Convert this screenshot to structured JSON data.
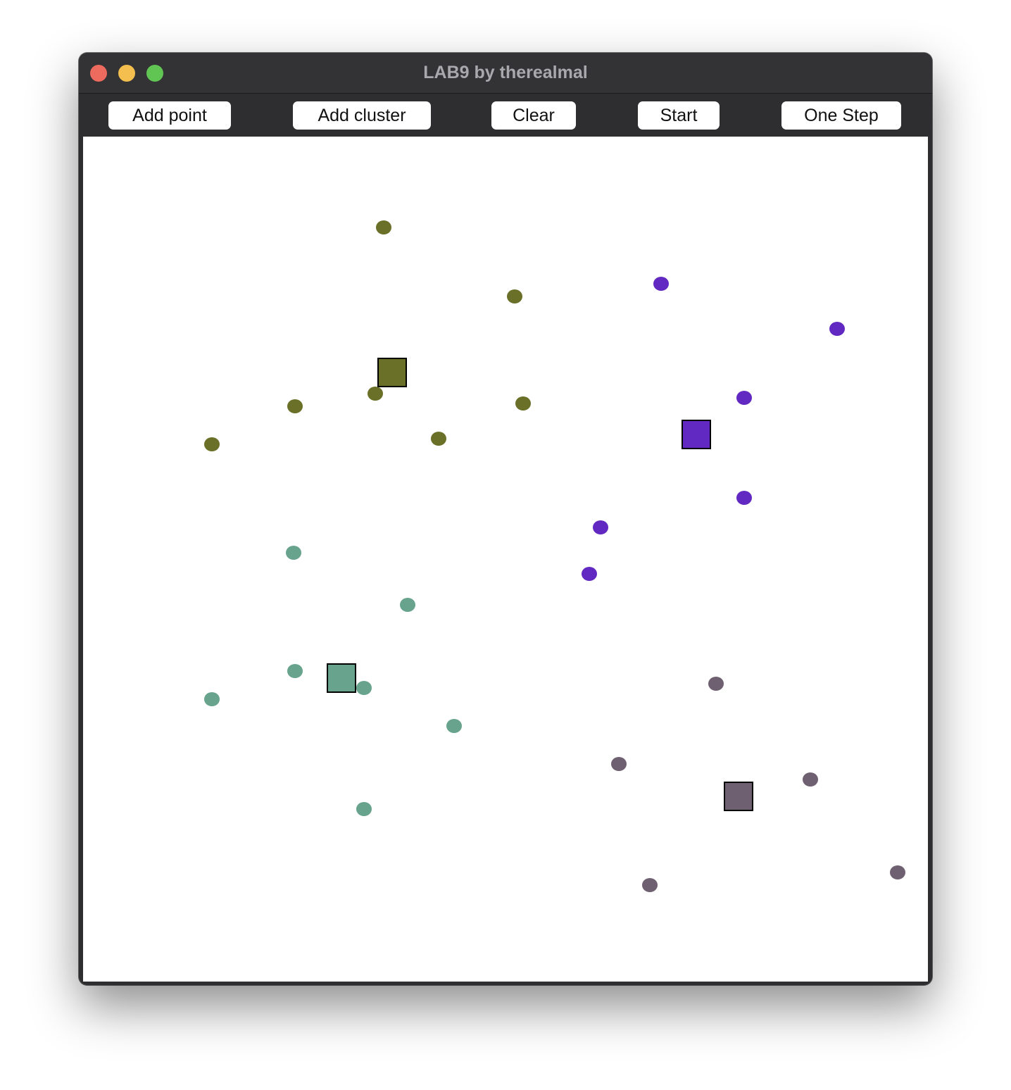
{
  "window": {
    "title": "LAB9 by therealmal"
  },
  "toolbar": {
    "add_point": "Add point",
    "add_cluster": "Add cluster",
    "clear": "Clear",
    "start": "Start",
    "one_step": "One Step"
  },
  "clusters": [
    {
      "color": "#6b7028",
      "center": [
        439,
        335
      ],
      "points": [
        [
          427,
          129
        ],
        [
          613,
          227
        ],
        [
          415,
          365
        ],
        [
          301,
          383
        ],
        [
          625,
          379
        ],
        [
          505,
          429
        ],
        [
          183,
          437
        ]
      ]
    },
    {
      "color": "#6228c2",
      "center": [
        871,
        423
      ],
      "points": [
        [
          821,
          209
        ],
        [
          1071,
          273
        ],
        [
          939,
          371
        ],
        [
          939,
          513
        ],
        [
          735,
          555
        ],
        [
          719,
          621
        ]
      ]
    },
    {
      "color": "#67a38d",
      "center": [
        367,
        769
      ],
      "points": [
        [
          299,
          591
        ],
        [
          461,
          665
        ],
        [
          301,
          759
        ],
        [
          399,
          783
        ],
        [
          183,
          799
        ],
        [
          527,
          837
        ],
        [
          399,
          955
        ]
      ]
    },
    {
      "color": "#6e6070",
      "center": [
        931,
        937
      ],
      "points": [
        [
          899,
          777
        ],
        [
          761,
          891
        ],
        [
          1033,
          913
        ],
        [
          1157,
          1045
        ],
        [
          805,
          1063
        ]
      ]
    }
  ]
}
